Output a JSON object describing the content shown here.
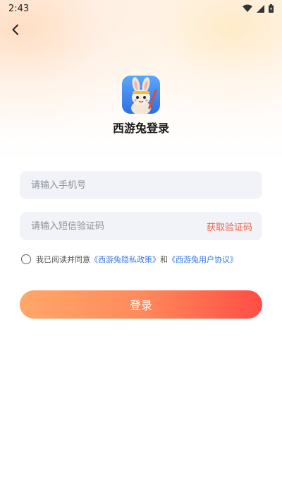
{
  "status_bar": {
    "time": "2:43"
  },
  "header": {
    "back_icon": "chevron-left-icon"
  },
  "app": {
    "title": "西游兔登录",
    "logo_icon": "rabbit-logo-icon"
  },
  "form": {
    "phone_placeholder": "请输入手机号",
    "phone_value": "",
    "code_placeholder": "请输入短信验证码",
    "code_value": "",
    "get_code_label": "获取验证码"
  },
  "agreement": {
    "checked": false,
    "prefix": "我已阅读并同意",
    "privacy_link": "《西游兔隐私政策》",
    "connector": "和",
    "terms_link": "《西游兔用户协议》"
  },
  "login_button": {
    "label": "登录"
  },
  "colors": {
    "accent_orange": "#f2604b",
    "link_blue": "#3a7ae8",
    "field_bg": "#f1f3f9",
    "button_start": "#ffa76a",
    "button_end": "#ff4d45"
  }
}
